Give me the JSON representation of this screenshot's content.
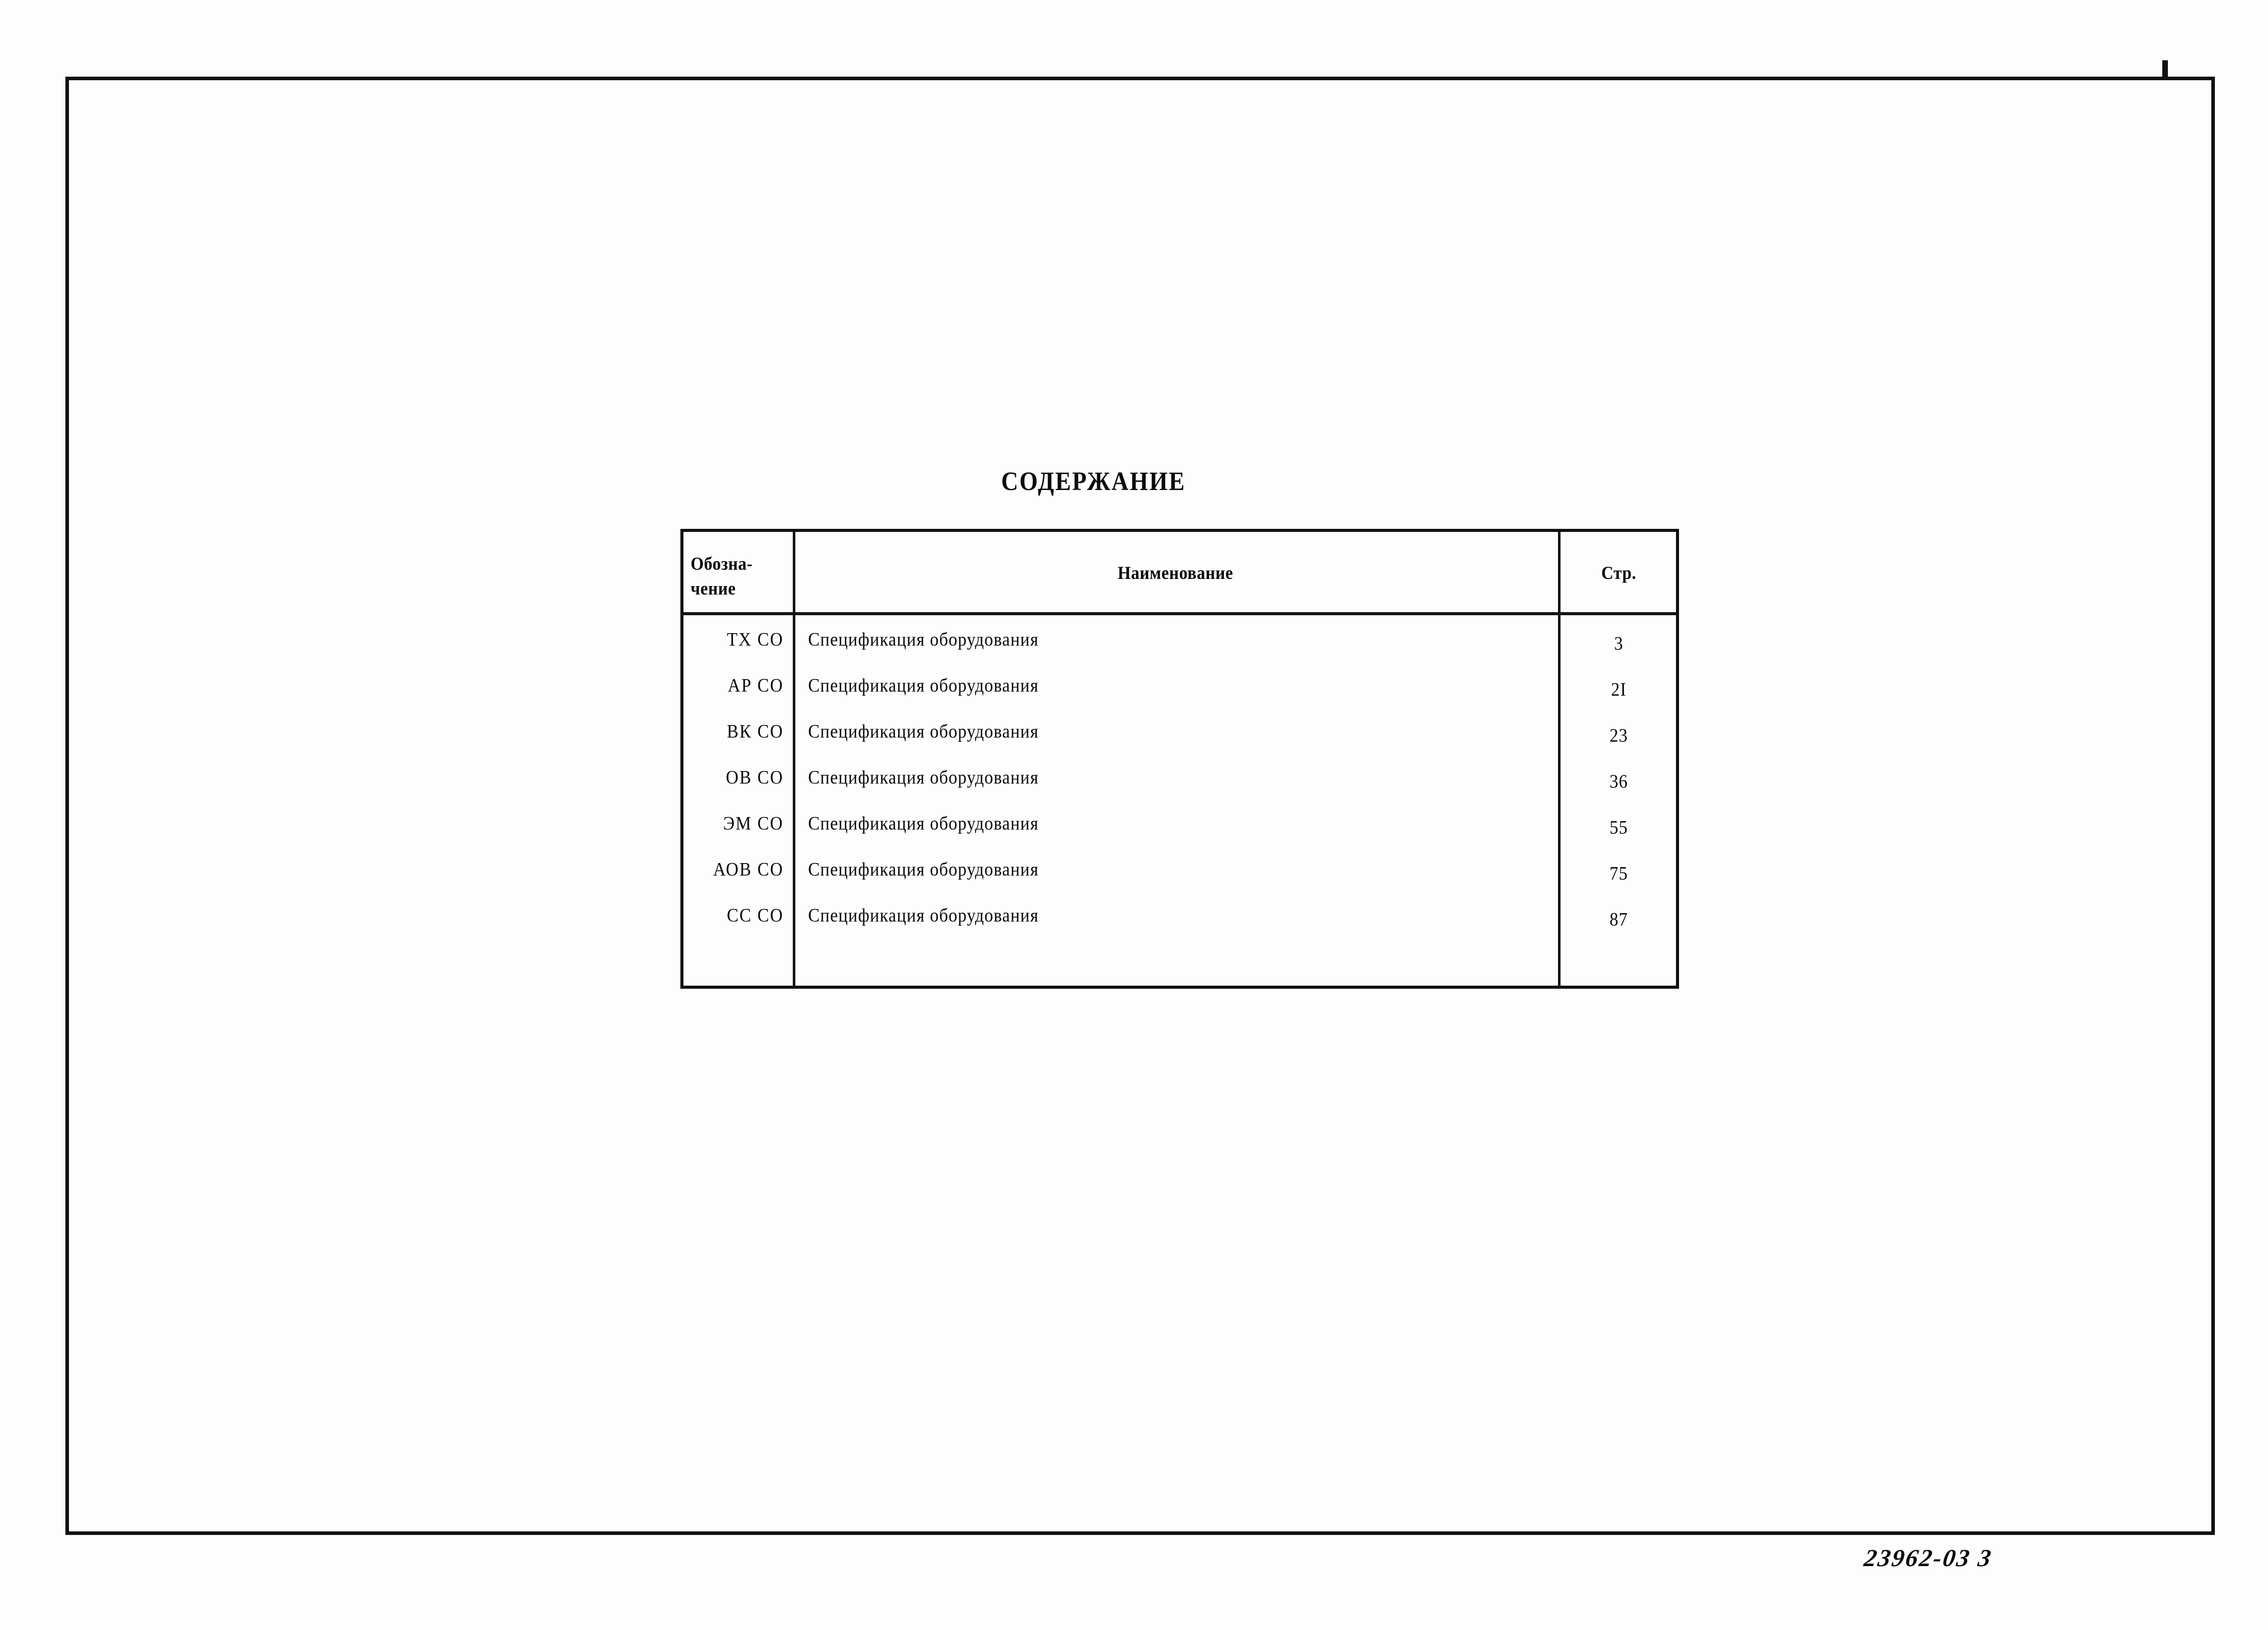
{
  "document": {
    "title": "СОДЕРЖАНИЕ",
    "sheet_marking": "23962-03  3"
  },
  "table": {
    "headers": {
      "designation": "Обозна-\nчение",
      "name": "Наименование",
      "page": "Стр."
    },
    "rows": [
      {
        "designation": "ТХ СО",
        "name": "Спецификация оборудования",
        "page": "3"
      },
      {
        "designation": "АР СО",
        "name": "Спецификация оборудования",
        "page": "2I"
      },
      {
        "designation": "ВК СО",
        "name": "Спецификация оборудования",
        "page": "23"
      },
      {
        "designation": "ОВ СО",
        "name": "Спецификация оборудования",
        "page": "36"
      },
      {
        "designation": "ЭМ СО",
        "name": "Спецификация оборудования",
        "page": "55"
      },
      {
        "designation": "АОВ СО",
        "name": "Спецификация оборудования",
        "page": "75"
      },
      {
        "designation": "СС СО",
        "name": "Спецификация оборудования",
        "page": "87"
      }
    ]
  },
  "colors": {
    "ink": "#0a0a0a",
    "rule": "#141414",
    "paper": "#fdfdfd"
  }
}
